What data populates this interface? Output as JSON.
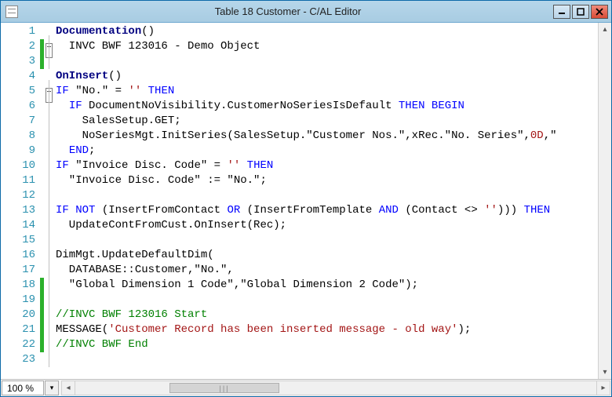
{
  "window": {
    "title": "Table 18 Customer - C/AL Editor"
  },
  "zoom": {
    "value": "100 %"
  },
  "lines": [
    {
      "n": 1,
      "green": false,
      "fold": "box",
      "tokens": [
        {
          "t": "typename",
          "v": "Documentation"
        },
        {
          "t": "",
          "v": "()"
        }
      ]
    },
    {
      "n": 2,
      "green": true,
      "fold": "line",
      "tokens": [
        {
          "t": "",
          "v": "  INVC BWF 123016 - Demo Object"
        }
      ]
    },
    {
      "n": 3,
      "green": true,
      "fold": "line",
      "tokens": []
    },
    {
      "n": 4,
      "green": false,
      "fold": "box",
      "tokens": [
        {
          "t": "typename",
          "v": "OnInsert"
        },
        {
          "t": "",
          "v": "()"
        }
      ]
    },
    {
      "n": 5,
      "green": false,
      "fold": "line",
      "tokens": [
        {
          "t": "kw",
          "v": "IF "
        },
        {
          "t": "",
          "v": "\"No.\" = "
        },
        {
          "t": "str",
          "v": "''"
        },
        {
          "t": "kw",
          "v": " THEN"
        }
      ]
    },
    {
      "n": 6,
      "green": false,
      "fold": "line",
      "tokens": [
        {
          "t": "",
          "v": "  "
        },
        {
          "t": "kw",
          "v": "IF "
        },
        {
          "t": "",
          "v": "DocumentNoVisibility.CustomerNoSeriesIsDefault "
        },
        {
          "t": "kw",
          "v": "THEN BEGIN"
        }
      ]
    },
    {
      "n": 7,
      "green": false,
      "fold": "line",
      "tokens": [
        {
          "t": "",
          "v": "    SalesSetup.GET;"
        }
      ]
    },
    {
      "n": 8,
      "green": false,
      "fold": "line",
      "tokens": [
        {
          "t": "",
          "v": "    NoSeriesMgt.InitSeries(SalesSetup.\"Customer Nos.\",xRec.\"No. Series\","
        },
        {
          "t": "num",
          "v": "0D"
        },
        {
          "t": "",
          "v": ",\""
        }
      ]
    },
    {
      "n": 9,
      "green": false,
      "fold": "line",
      "tokens": [
        {
          "t": "",
          "v": "  "
        },
        {
          "t": "kw",
          "v": "END"
        },
        {
          "t": "",
          "v": ";"
        }
      ]
    },
    {
      "n": 10,
      "green": false,
      "fold": "line",
      "tokens": [
        {
          "t": "kw",
          "v": "IF "
        },
        {
          "t": "",
          "v": "\"Invoice Disc. Code\" = "
        },
        {
          "t": "str",
          "v": "''"
        },
        {
          "t": "kw",
          "v": " THEN"
        }
      ]
    },
    {
      "n": 11,
      "green": false,
      "fold": "line",
      "tokens": [
        {
          "t": "",
          "v": "  \"Invoice Disc. Code\" := \"No.\";"
        }
      ]
    },
    {
      "n": 12,
      "green": false,
      "fold": "line",
      "tokens": []
    },
    {
      "n": 13,
      "green": false,
      "fold": "line",
      "tokens": [
        {
          "t": "kw",
          "v": "IF NOT "
        },
        {
          "t": "",
          "v": "(InsertFromContact "
        },
        {
          "t": "kw",
          "v": "OR "
        },
        {
          "t": "",
          "v": "(InsertFromTemplate "
        },
        {
          "t": "kw",
          "v": "AND "
        },
        {
          "t": "",
          "v": "(Contact <> "
        },
        {
          "t": "str",
          "v": "''"
        },
        {
          "t": "",
          "v": "))) "
        },
        {
          "t": "kw",
          "v": "THEN"
        }
      ]
    },
    {
      "n": 14,
      "green": false,
      "fold": "line",
      "tokens": [
        {
          "t": "",
          "v": "  UpdateContFromCust.OnInsert(Rec);"
        }
      ]
    },
    {
      "n": 15,
      "green": false,
      "fold": "line",
      "tokens": []
    },
    {
      "n": 16,
      "green": false,
      "fold": "line",
      "tokens": [
        {
          "t": "",
          "v": "DimMgt.UpdateDefaultDim("
        }
      ]
    },
    {
      "n": 17,
      "green": false,
      "fold": "line",
      "tokens": [
        {
          "t": "",
          "v": "  DATABASE::Customer,\"No.\","
        }
      ]
    },
    {
      "n": 18,
      "green": true,
      "fold": "line",
      "tokens": [
        {
          "t": "",
          "v": "  \"Global Dimension 1 Code\",\"Global Dimension 2 Code\");"
        }
      ]
    },
    {
      "n": 19,
      "green": true,
      "fold": "line",
      "tokens": []
    },
    {
      "n": 20,
      "green": true,
      "fold": "line",
      "tokens": [
        {
          "t": "comment",
          "v": "//INVC BWF 123016 Start"
        }
      ]
    },
    {
      "n": 21,
      "green": true,
      "fold": "line",
      "tokens": [
        {
          "t": "",
          "v": "MESSAGE("
        },
        {
          "t": "str",
          "v": "'Customer Record has been inserted message - old way'"
        },
        {
          "t": "",
          "v": ");"
        }
      ]
    },
    {
      "n": 22,
      "green": true,
      "fold": "line",
      "tokens": [
        {
          "t": "comment",
          "v": "//INVC BWF End"
        }
      ]
    },
    {
      "n": 23,
      "green": false,
      "fold": "line",
      "tokens": []
    }
  ]
}
